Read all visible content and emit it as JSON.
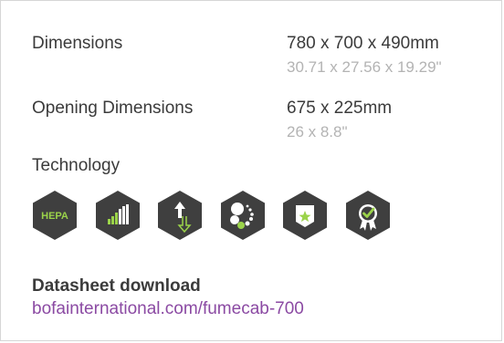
{
  "specs": [
    {
      "label": "Dimensions",
      "value": "780 x 700 x 490mm",
      "sub": "30.71 x 27.56 x 19.29\""
    },
    {
      "label": "Opening Dimensions",
      "value": "675 x 225mm",
      "sub": "26 x 8.8\""
    }
  ],
  "technology": {
    "title": "Technology",
    "icons": [
      {
        "name": "hepa-icon",
        "text": "HEPA"
      },
      {
        "name": "signal-bars-icon"
      },
      {
        "name": "airflow-arrows-icon"
      },
      {
        "name": "dots-cluster-icon"
      },
      {
        "name": "shield-star-icon"
      },
      {
        "name": "approved-badge-icon"
      }
    ]
  },
  "download": {
    "title": "Datasheet download",
    "link": "bofainternational.com/fumecab-700"
  },
  "colors": {
    "hex_bg": "#3f3f3f",
    "accent_green": "#9bd34a",
    "link_purple": "#8b4aa3"
  }
}
